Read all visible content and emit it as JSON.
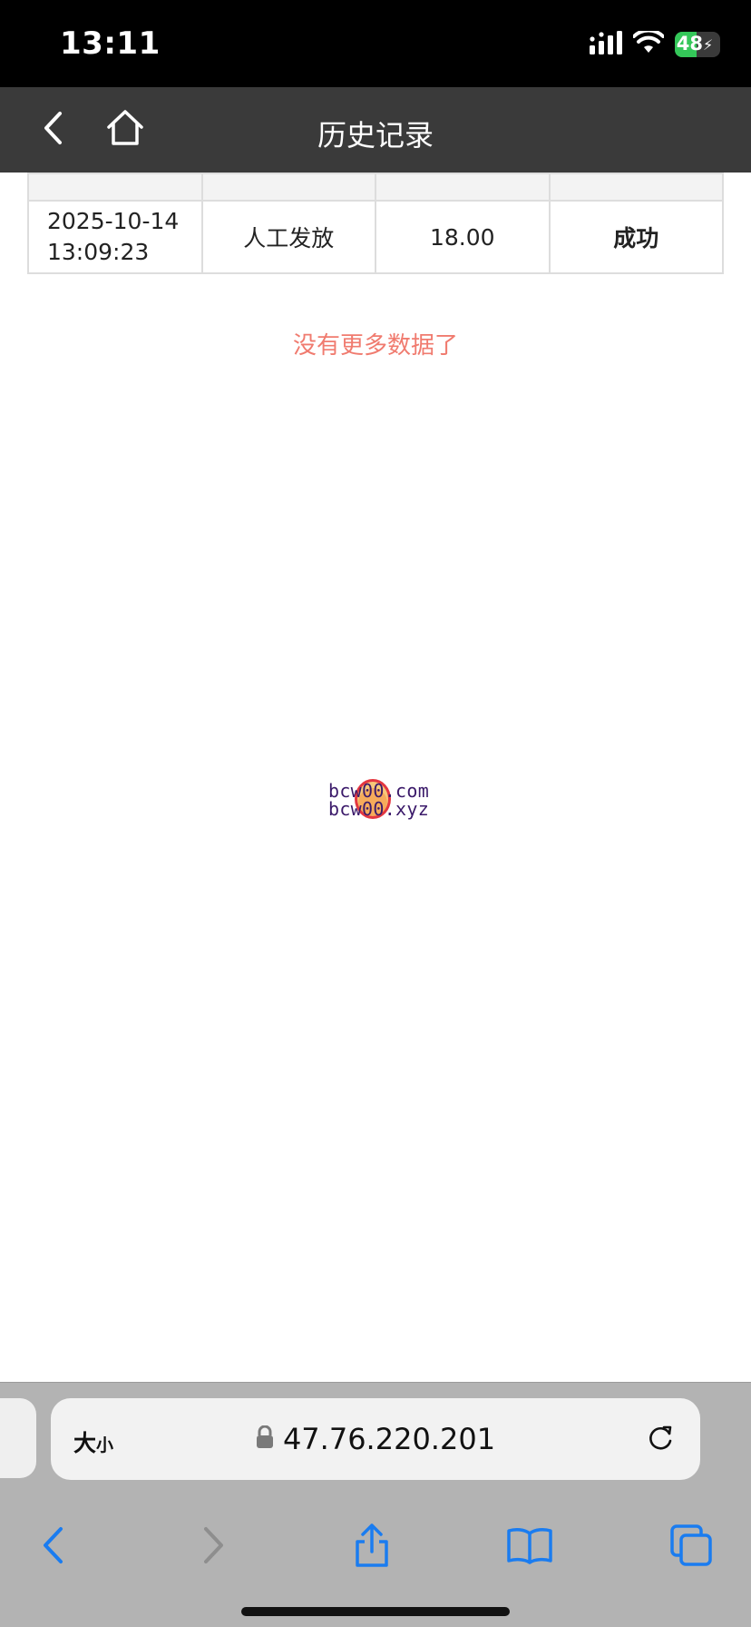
{
  "status_bar": {
    "time": "13:11",
    "battery_label": "48",
    "battery_level_percent": 48
  },
  "header": {
    "title": "历史记录"
  },
  "table": {
    "rows": [
      {
        "date": "2025-10-14",
        "time": "13:09:23",
        "type": "人工发放",
        "amount": "18.00",
        "status": "成功"
      }
    ]
  },
  "no_more_text": "没有更多数据了",
  "watermark": {
    "line1": "bcw00.com",
    "line2": "bcw00.xyz"
  },
  "browser": {
    "size_label_big": "大",
    "size_label_small": "小",
    "url": "47.76.220.201"
  },
  "colors": {
    "header_bg": "#3a3a3a",
    "accent_blue": "#1a7cf0",
    "no_more_color": "#f07b6f",
    "battery_green": "#34c759"
  },
  "icons": {
    "back": "chevron-left-icon",
    "home": "home-icon",
    "lock": "lock-icon",
    "reload": "reload-icon",
    "browser_back": "chevron-left-icon",
    "browser_forward": "chevron-right-icon",
    "share": "share-icon",
    "bookmarks": "book-icon",
    "tabs": "tabs-icon"
  }
}
